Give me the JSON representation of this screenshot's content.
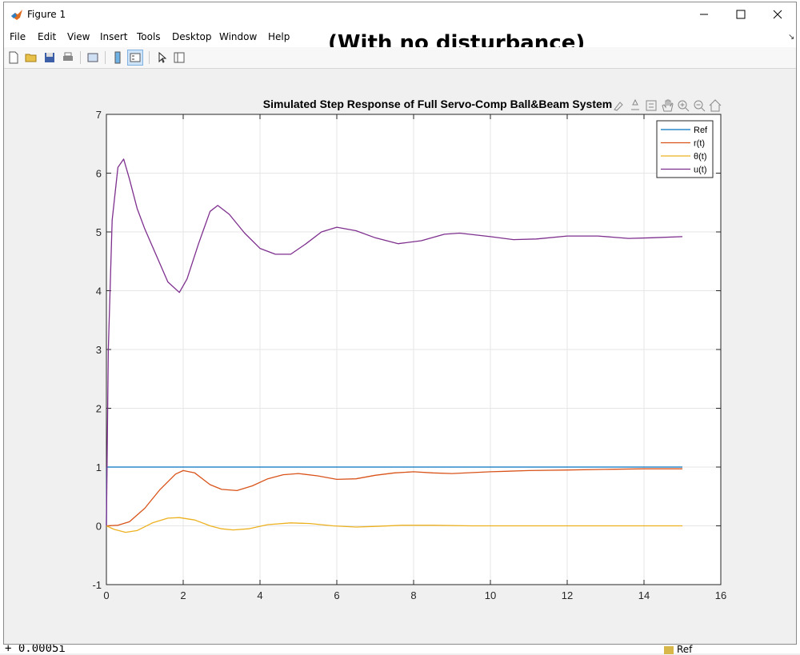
{
  "window": {
    "title": "Figure 1"
  },
  "menu": [
    "File",
    "Edit",
    "View",
    "Insert",
    "Tools",
    "Desktop",
    "Window",
    "Help"
  ],
  "annotation": "(With no disturbance)",
  "background": {
    "command_window_fragment": "+ 0.0005i",
    "workspace_item": "Ref"
  },
  "toolbar": {
    "icons": [
      "new-figure-icon",
      "open-file-icon",
      "save-icon",
      "print-icon",
      "link-plot-icon",
      "insert-colorbar-icon",
      "insert-legend-icon",
      "edit-plot-icon",
      "property-inspector-icon"
    ]
  },
  "axes_toolbar": {
    "icons": [
      "brush-icon",
      "data-tips-icon",
      "export-icon",
      "pan-icon",
      "zoom-in-icon",
      "zoom-out-icon",
      "home-icon"
    ]
  },
  "chart_data": {
    "type": "line",
    "title": "Simulated Step Response of Full Servo-Comp Ball&Beam System",
    "xlabel": "",
    "ylabel": "",
    "xlim": [
      0,
      16
    ],
    "ylim": [
      -1,
      7
    ],
    "xticks": [
      "0",
      "2",
      "4",
      "6",
      "8",
      "10",
      "12",
      "14",
      "16"
    ],
    "yticks": [
      "-1",
      "0",
      "1",
      "2",
      "3",
      "4",
      "5",
      "6",
      "7"
    ],
    "grid": true,
    "legend_position": "top-right",
    "series": [
      {
        "name": "Ref",
        "color": "#0072BD",
        "x": [
          0,
          0.01,
          15
        ],
        "y": [
          0,
          1,
          1
        ]
      },
      {
        "name": "r(t)",
        "color": "#D95319",
        "x": [
          0,
          0.3,
          0.6,
          1.0,
          1.4,
          1.8,
          2.0,
          2.3,
          2.7,
          3.0,
          3.4,
          3.8,
          4.2,
          4.6,
          5.0,
          5.5,
          6.0,
          6.5,
          7.0,
          7.5,
          8.0,
          8.5,
          9.0,
          10.0,
          11.0,
          12.0,
          13.0,
          14.0,
          15.0
        ],
        "y": [
          0,
          0.01,
          0.07,
          0.3,
          0.62,
          0.88,
          0.94,
          0.9,
          0.7,
          0.62,
          0.6,
          0.68,
          0.8,
          0.87,
          0.89,
          0.85,
          0.79,
          0.8,
          0.86,
          0.9,
          0.92,
          0.9,
          0.89,
          0.92,
          0.94,
          0.95,
          0.96,
          0.97,
          0.97
        ]
      },
      {
        "name": "θ(t)",
        "color": "#EDB120",
        "x": [
          0,
          0.2,
          0.5,
          0.8,
          1.2,
          1.6,
          1.9,
          2.3,
          2.7,
          3.0,
          3.3,
          3.7,
          4.2,
          4.8,
          5.3,
          5.9,
          6.5,
          7.0,
          7.7,
          8.5,
          9.5,
          10.5,
          12.0,
          13.5,
          15.0
        ],
        "y": [
          0,
          -0.06,
          -0.11,
          -0.08,
          0.05,
          0.13,
          0.14,
          0.1,
          0.0,
          -0.05,
          -0.07,
          -0.05,
          0.02,
          0.05,
          0.04,
          0.0,
          -0.02,
          -0.01,
          0.01,
          0.01,
          0.0,
          0.0,
          0.0,
          0.0,
          0.0
        ]
      },
      {
        "name": "u(t)",
        "color": "#7E2F8E",
        "x": [
          0,
          0.05,
          0.15,
          0.3,
          0.45,
          0.6,
          0.8,
          1.0,
          1.3,
          1.6,
          1.9,
          2.1,
          2.4,
          2.7,
          2.9,
          3.2,
          3.6,
          4.0,
          4.4,
          4.8,
          5.2,
          5.6,
          6.0,
          6.5,
          7.0,
          7.6,
          8.2,
          8.8,
          9.2,
          10.0,
          10.6,
          11.2,
          12.0,
          12.8,
          13.6,
          14.2,
          15.0
        ],
        "y": [
          0,
          3.0,
          5.2,
          6.1,
          6.24,
          5.9,
          5.4,
          5.05,
          4.6,
          4.15,
          3.97,
          4.2,
          4.8,
          5.35,
          5.45,
          5.3,
          4.98,
          4.72,
          4.62,
          4.62,
          4.8,
          5.0,
          5.08,
          5.02,
          4.9,
          4.8,
          4.85,
          4.96,
          4.98,
          4.92,
          4.87,
          4.88,
          4.93,
          4.93,
          4.89,
          4.9,
          4.92
        ]
      }
    ]
  }
}
